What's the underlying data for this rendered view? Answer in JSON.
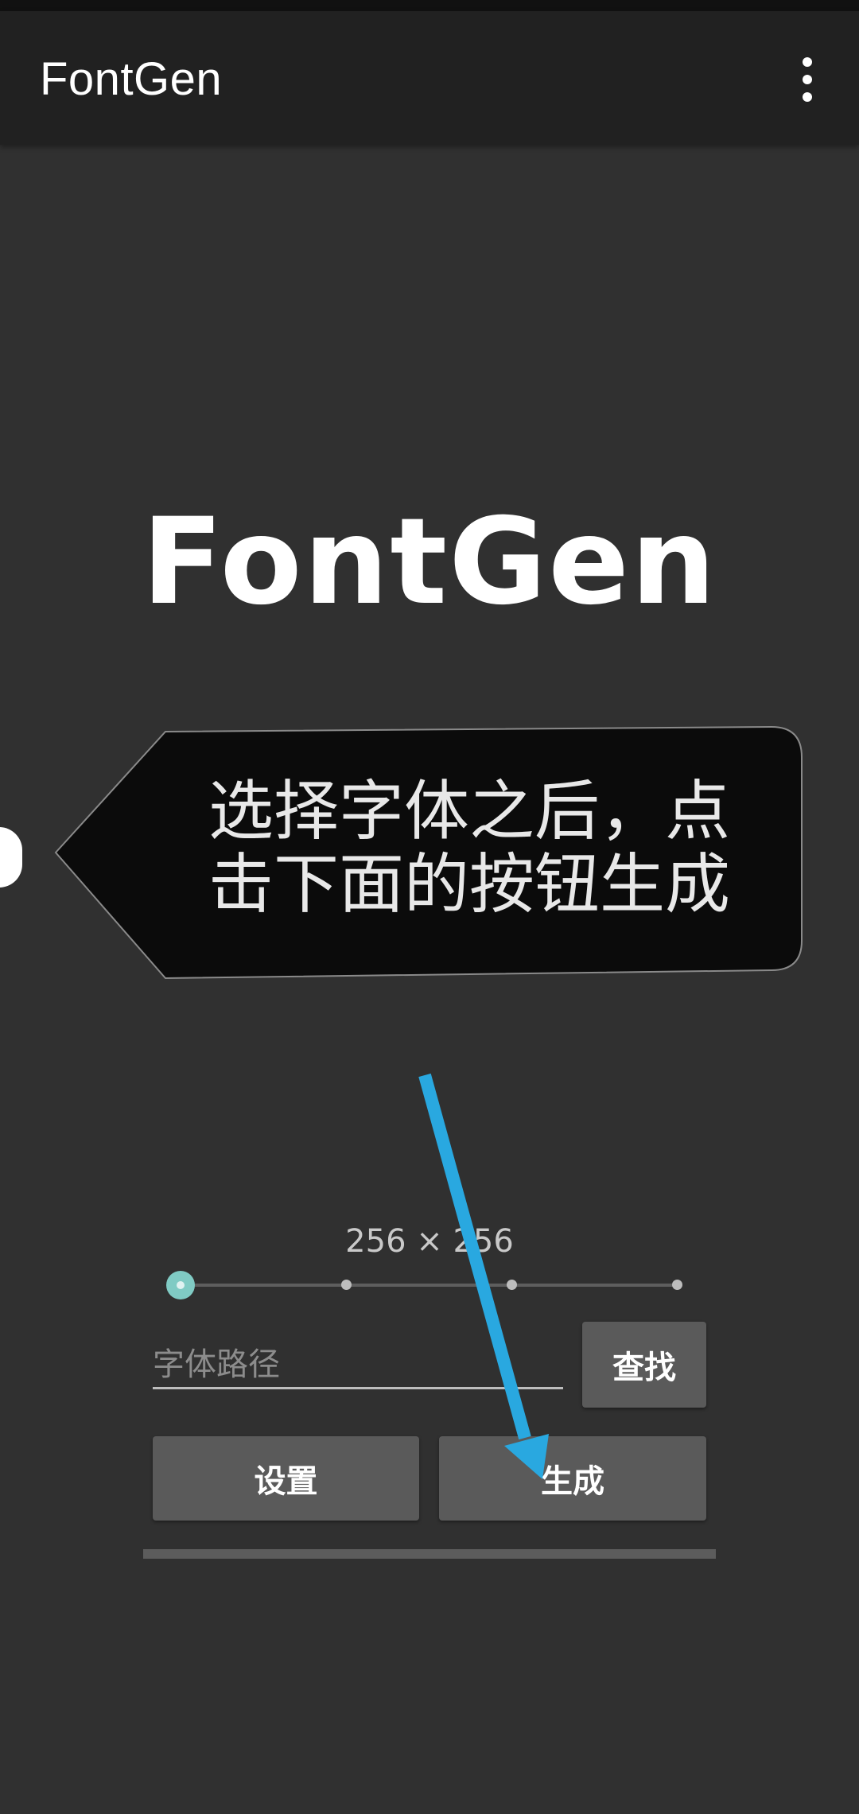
{
  "status_bar": {},
  "app_bar": {
    "title": "FontGen",
    "overflow_icon": "more-vert-icon"
  },
  "hero": {
    "title": "FontGen"
  },
  "tooltip": {
    "line1": "选择字体之后，点",
    "line2": "击下面的按钮生成"
  },
  "size_slider": {
    "label": "256 × 256",
    "step_count": 4,
    "selected_index": 0,
    "thumb_color": "#80cbc4"
  },
  "font_path": {
    "value": "",
    "placeholder": "字体路径"
  },
  "buttons": {
    "find": "查找",
    "settings": "设置",
    "generate": "生成"
  },
  "colors": {
    "background": "#303030",
    "app_bar": "#212121",
    "button": "#5a5a5a",
    "annotation_arrow": "#29a8e0"
  }
}
